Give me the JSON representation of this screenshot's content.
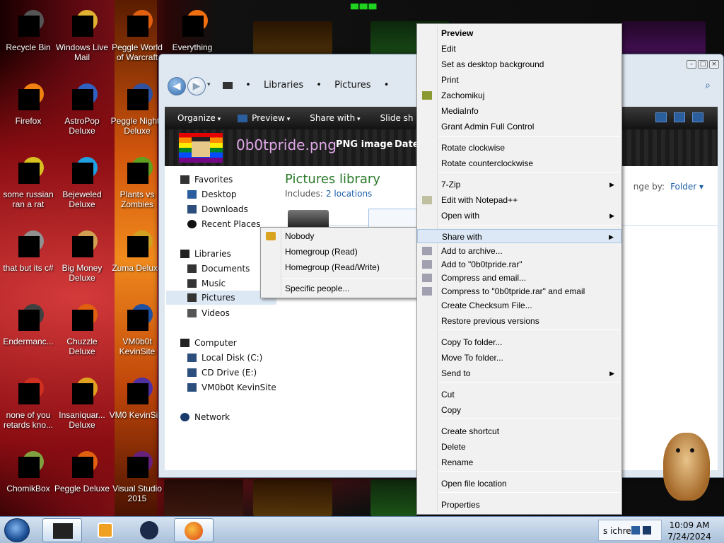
{
  "desktop": {
    "icons": [
      {
        "label": "Recycle Bin",
        "icon": "recycle-bin-icon",
        "color": "#555555"
      },
      {
        "label": "Windows Live Mail",
        "icon": "mail-icon",
        "color": "#e0b030"
      },
      {
        "label": "Peggle World of Warcraft",
        "icon": "peggle-icon",
        "color": "#e06010"
      },
      {
        "label": "Everything",
        "icon": "search-magnifier-icon",
        "color": "#f07010"
      },
      {
        "label": "Firefox",
        "icon": "firefox-icon",
        "color": "#f08010"
      },
      {
        "label": "AstroPop Deluxe",
        "icon": "astropop-icon",
        "color": "#3060c0"
      },
      {
        "label": "Peggle Nights Deluxe",
        "icon": "peggle-nights-icon",
        "color": "#3050a0"
      },
      {
        "label": "some russian ran a rat",
        "icon": "java-icon",
        "color": "#d8c020"
      },
      {
        "label": "Bejeweled Deluxe",
        "icon": "bejeweled-icon",
        "color": "#20a0e0"
      },
      {
        "label": "Plants vs Zombies",
        "icon": "plants-vs-zombies-icon",
        "color": "#60a020"
      },
      {
        "label": "that but its c#",
        "icon": "shortcut-icon",
        "color": "#909090"
      },
      {
        "label": "Big Money Deluxe",
        "icon": "big-money-icon",
        "color": "#d0a050"
      },
      {
        "label": "Zuma Deluxe",
        "icon": "zuma-icon",
        "color": "#d0a020"
      },
      {
        "label": "Endermanc...",
        "icon": "terminal-icon",
        "color": "#404040"
      },
      {
        "label": "Chuzzle Deluxe",
        "icon": "chuzzle-icon",
        "color": "#e06010"
      },
      {
        "label": "VM0b0t KevinSite",
        "icon": "vm-icon",
        "color": "#2050a0"
      },
      {
        "label": "none of you retards kno...",
        "icon": "chrome-icon",
        "color": "#d03020"
      },
      {
        "label": "Insaniquar... Deluxe",
        "icon": "insaniquarium-icon",
        "color": "#e0a020"
      },
      {
        "label": "VM0 KevinSi...",
        "icon": "vm-icon-2",
        "color": "#5030a0"
      },
      {
        "label": "ChomikBox",
        "icon": "chomikbox-icon",
        "color": "#80a040"
      },
      {
        "label": "Peggle Deluxe",
        "icon": "peggle-deluxe-icon",
        "color": "#e06010"
      },
      {
        "label": "Visual Studio 2015",
        "icon": "visual-studio-icon",
        "color": "#68217a"
      }
    ]
  },
  "explorer": {
    "breadcrumb": [
      "Libraries",
      "Pictures"
    ],
    "toolbar": [
      "Organize",
      "Preview",
      "Share with",
      "Slide sh"
    ],
    "preview": {
      "filename": "0b0tpride.png",
      "filetype": "PNG image",
      "date_label": "Date ta"
    },
    "nav": {
      "favorites": "Favorites",
      "desktop": "Desktop",
      "downloads": "Downloads",
      "recent": "Recent Places",
      "libraries": "Libraries",
      "documents": "Documents",
      "music": "Music",
      "pictures": "Pictures",
      "videos": "Videos",
      "computer": "Computer",
      "local_disk": "Local Disk (C:)",
      "cd_drive": "CD Drive (E:)",
      "vm_drive": "VM0b0t KevinSite",
      "network": "Network"
    },
    "library": {
      "title": "Pictures library",
      "includes_label": "Includes:",
      "includes_link": "2 locations",
      "arrange_label": "nge by:",
      "arrange_value": "Folder"
    }
  },
  "context_menu": {
    "items": [
      {
        "label": "Preview",
        "bold": true
      },
      {
        "label": "Edit"
      },
      {
        "label": "Set as desktop background"
      },
      {
        "label": "Print"
      },
      {
        "label": "Zachomikuj",
        "icon": "chomikuj-icon"
      },
      {
        "label": "MediaInfo"
      },
      {
        "label": "Grant Admin Full Control"
      },
      {
        "label": "Rotate clockwise"
      },
      {
        "label": "Rotate counterclockwise"
      },
      {
        "label": "7-Zip",
        "submenu": true
      },
      {
        "label": "Edit with Notepad++",
        "icon": "notepad-plus-icon"
      },
      {
        "label": "Open with",
        "submenu": true
      },
      {
        "label": "Share with",
        "submenu": true,
        "highlighted": true
      },
      {
        "label": "Add to archive...",
        "icon": "winrar-icon"
      },
      {
        "label": "Add to \"0b0tpride.rar\"",
        "icon": "winrar-icon"
      },
      {
        "label": "Compress and email...",
        "icon": "winrar-icon"
      },
      {
        "label": "Compress to \"0b0tpride.rar\" and email",
        "icon": "winrar-icon"
      },
      {
        "label": "Create Checksum File..."
      },
      {
        "label": "Restore previous versions"
      },
      {
        "label": "Copy To folder..."
      },
      {
        "label": "Move To folder..."
      },
      {
        "label": "Send to",
        "submenu": true
      },
      {
        "label": "Cut"
      },
      {
        "label": "Copy"
      },
      {
        "label": "Create shortcut"
      },
      {
        "label": "Delete"
      },
      {
        "label": "Rename"
      },
      {
        "label": "Open file location"
      },
      {
        "label": "Properties"
      }
    ]
  },
  "share_submenu": {
    "items": [
      {
        "label": "Nobody",
        "icon": "lock-icon"
      },
      {
        "label": "Homegroup (Read)"
      },
      {
        "label": "Homegroup (Read/Write)"
      },
      {
        "label": "Specific people..."
      }
    ]
  },
  "taskbar": {
    "tray_text": "s",
    "tray_label": "ichresa",
    "time": "10:09 AM",
    "date": "7/24/2024"
  },
  "colors": {
    "accent": "#1a5ea8",
    "library_title": "#2a7a2a",
    "menu_highlight": "#dce8f5"
  }
}
